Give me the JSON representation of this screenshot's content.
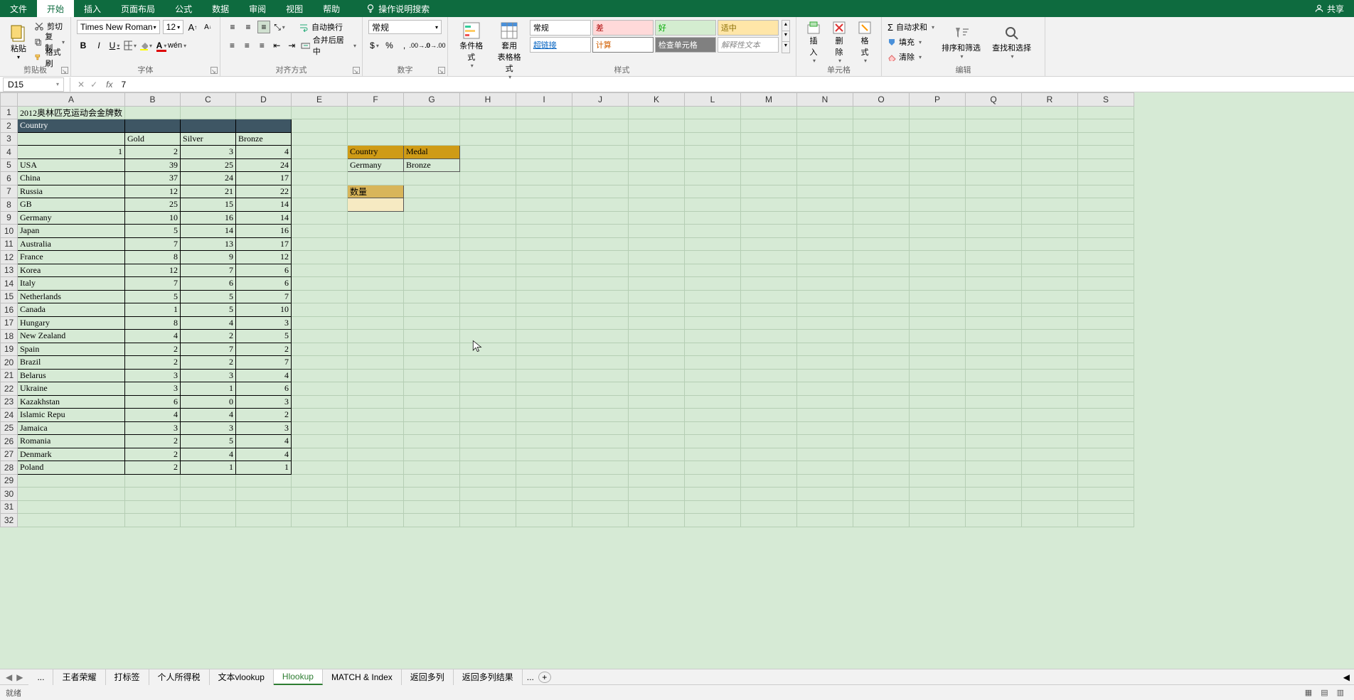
{
  "app": {
    "share": "共享",
    "tellme": "操作说明搜索"
  },
  "tabs": {
    "file": "文件",
    "home": "开始",
    "insert": "插入",
    "layout": "页面布局",
    "formulas": "公式",
    "data": "数据",
    "review": "审阅",
    "view": "视图",
    "help": "帮助"
  },
  "ribbon": {
    "clipboard": {
      "label": "剪贴板",
      "paste": "粘贴",
      "cut": "剪切",
      "copy": "复制",
      "format_painter": "格式刷"
    },
    "font": {
      "label": "字体",
      "name": "Times New Roman",
      "size": "12"
    },
    "alignment": {
      "label": "对齐方式",
      "wrap": "自动换行",
      "merge": "合并后居中"
    },
    "number": {
      "label": "数字",
      "format": "常规"
    },
    "styles": {
      "label": "样式",
      "cond": "条件格式",
      "table": "套用\n表格格式",
      "normal": "常规",
      "bad": "差",
      "good": "好",
      "neutral": "适中",
      "link": "超链接",
      "calc": "计算",
      "check": "检查单元格",
      "explain": "解释性文本"
    },
    "cells": {
      "label": "单元格",
      "insert": "插入",
      "delete": "删除",
      "format": "格式"
    },
    "editing": {
      "label": "编辑",
      "autosum": "自动求和",
      "fill": "填充",
      "clear": "清除",
      "sortfilter": "排序和筛选",
      "findselect": "查找和选择"
    }
  },
  "formulabar": {
    "name": "D15",
    "value": "7"
  },
  "columns": [
    "A",
    "B",
    "C",
    "D",
    "E",
    "F",
    "G",
    "H",
    "I",
    "J",
    "K",
    "L",
    "M",
    "N",
    "O",
    "P",
    "Q",
    "R",
    "S"
  ],
  "sheetdata": {
    "title": "2012奥林匹克运动会金牌数",
    "country_hdr": "Country",
    "medal_hdrs": {
      "gold": "Gold",
      "silver": "Silver",
      "bronze": "Bronze"
    },
    "nums_row": [
      "1",
      "2",
      "3",
      "4"
    ],
    "rows": [
      [
        "USA",
        "39",
        "25",
        "24"
      ],
      [
        "China",
        "37",
        "24",
        "17"
      ],
      [
        "Russia",
        "12",
        "21",
        "22"
      ],
      [
        "GB",
        "25",
        "15",
        "14"
      ],
      [
        "Germany",
        "10",
        "16",
        "14"
      ],
      [
        "Japan",
        "5",
        "14",
        "16"
      ],
      [
        "Australia",
        "7",
        "13",
        "17"
      ],
      [
        "France",
        "8",
        "9",
        "12"
      ],
      [
        "Korea",
        "12",
        "7",
        "6"
      ],
      [
        "Italy",
        "7",
        "6",
        "6"
      ],
      [
        "Netherlands",
        "5",
        "5",
        "7"
      ],
      [
        "Canada",
        "1",
        "5",
        "10"
      ],
      [
        "Hungary",
        "8",
        "4",
        "3"
      ],
      [
        "New Zealand",
        "4",
        "2",
        "5"
      ],
      [
        "Spain",
        "2",
        "7",
        "2"
      ],
      [
        "Brazil",
        "2",
        "2",
        "7"
      ],
      [
        "Belarus",
        "3",
        "3",
        "4"
      ],
      [
        "Ukraine",
        "3",
        "1",
        "6"
      ],
      [
        "Kazakhstan",
        "6",
        "0",
        "3"
      ],
      [
        "Islamic Repu",
        "4",
        "4",
        "2"
      ],
      [
        "Jamaica",
        "3",
        "3",
        "3"
      ],
      [
        "Romania",
        "2",
        "5",
        "4"
      ],
      [
        "Denmark",
        "2",
        "4",
        "4"
      ],
      [
        "Poland",
        "2",
        "1",
        "1"
      ]
    ],
    "lookup": {
      "country_label": "Country",
      "medal_label": "Medal",
      "country_val": "Germany",
      "medal_val": "Bronze",
      "qty_label": "数量"
    }
  },
  "sheets": {
    "more": "...",
    "tabs": [
      "王者荣耀",
      "打标签",
      "个人所得税",
      "文本vlookup",
      "Hlookup",
      "MATCH & Index",
      "返回多列",
      "返回多列结果"
    ],
    "active": "Hlookup"
  },
  "status": {
    "ready": "就绪"
  }
}
